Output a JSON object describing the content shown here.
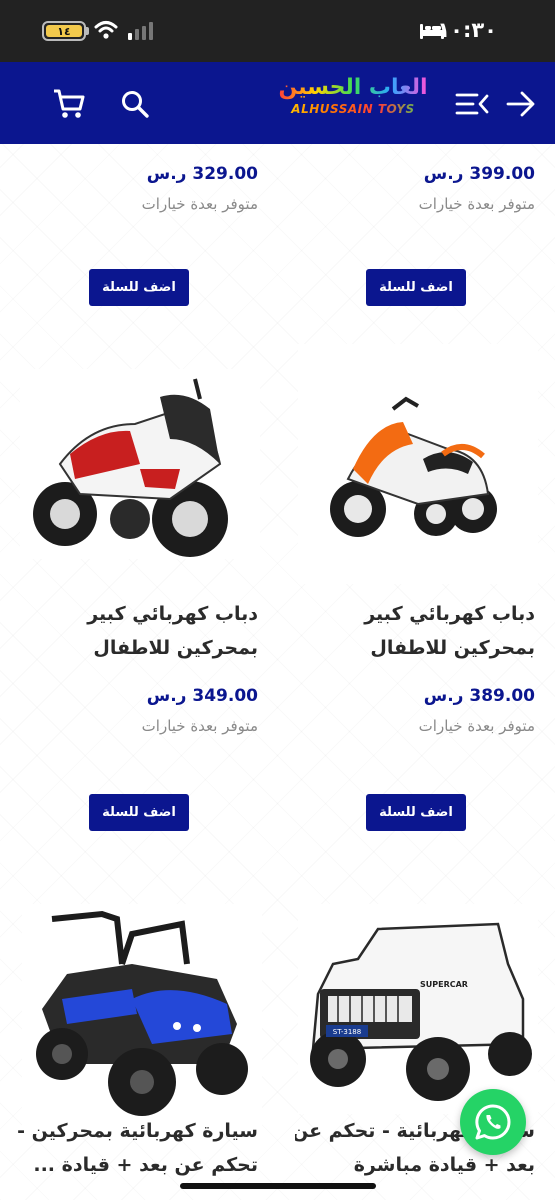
{
  "status_bar": {
    "time": "١٠:٣٠",
    "battery": "١٤"
  },
  "header": {
    "logo_ar": "العاب الحسين",
    "logo_en": "ALHUSSAIN TOYS",
    "icons": [
      "back-arrow-icon",
      "menu-icon",
      "search-icon",
      "cart-icon"
    ],
    "brand_color": "#0b168f"
  },
  "products": [
    {
      "title": [],
      "price": "399.00 ر.س",
      "availability": "متوفر بعدة خيارات",
      "button": "اضف للسلة"
    },
    {
      "title": [],
      "price": "329.00 ر.س",
      "availability": "متوفر بعدة خيارات",
      "button": "اضف للسلة"
    },
    {
      "title": [
        "دباب كهربائي كبير",
        "بمحركين للاطفال"
      ],
      "price": "389.00 ر.س",
      "availability": "متوفر بعدة خيارات",
      "button": "اضف للسلة",
      "image": "orange-white-electric-motorcycle"
    },
    {
      "title": [
        "دباب كهربائي كبير",
        "بمحركين للاطفال"
      ],
      "price": "349.00 ر.س",
      "availability": "متوفر بعدة خيارات",
      "button": "اضف للسلة",
      "image": "red-white-electric-motorcycle"
    },
    {
      "title": [
        "سيارة كهربائية - تحكم عن",
        "بعد + قيادة مباشرة"
      ],
      "image": "white-electric-jeep",
      "image_text": [
        "SUPERCAR",
        "ST-3188"
      ]
    },
    {
      "title": [
        "سيارة كهربائية بمحركين -",
        "تحكم عن بعد + قيادة ..."
      ],
      "image": "blue-electric-buggy"
    }
  ],
  "whatsapp": {
    "icon": "whatsapp-icon",
    "color": "#25d366"
  }
}
